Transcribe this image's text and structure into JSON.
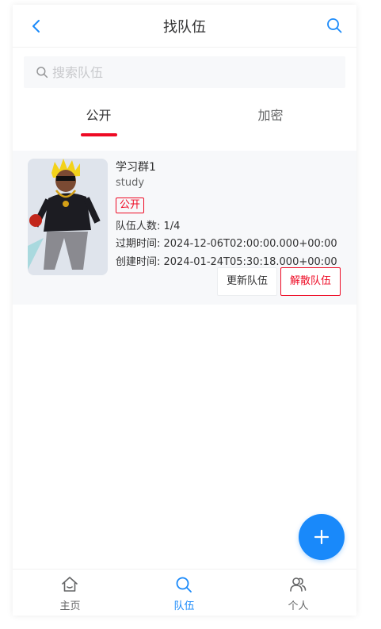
{
  "navbar": {
    "title": "找队伍",
    "back_icon": "chevron-left-icon",
    "search_icon": "search-icon"
  },
  "search": {
    "placeholder": "搜索队伍",
    "value": ""
  },
  "tabs": [
    {
      "label": "公开",
      "active": true
    },
    {
      "label": "加密",
      "active": false
    }
  ],
  "teams": [
    {
      "name": "学习群1",
      "description": "study",
      "status_tag": "公开",
      "members": "队伍人数: 1/4",
      "expire": "过期时间: 2024-12-06T02:00:00.000+00:00",
      "created": "创建时间: 2024-01-24T05:30:18.000+00:00",
      "update_label": "更新队伍",
      "dissolve_label": "解散队伍"
    }
  ],
  "fab": {
    "icon": "plus-icon"
  },
  "tabbar": [
    {
      "label": "主页",
      "icon": "home-icon",
      "active": false
    },
    {
      "label": "队伍",
      "icon": "search-icon",
      "active": true
    },
    {
      "label": "个人",
      "icon": "friends-icon",
      "active": false
    }
  ],
  "colors": {
    "primary": "#1989fa",
    "danger": "#ee0a24",
    "text": "#323233",
    "muted": "#646566"
  }
}
